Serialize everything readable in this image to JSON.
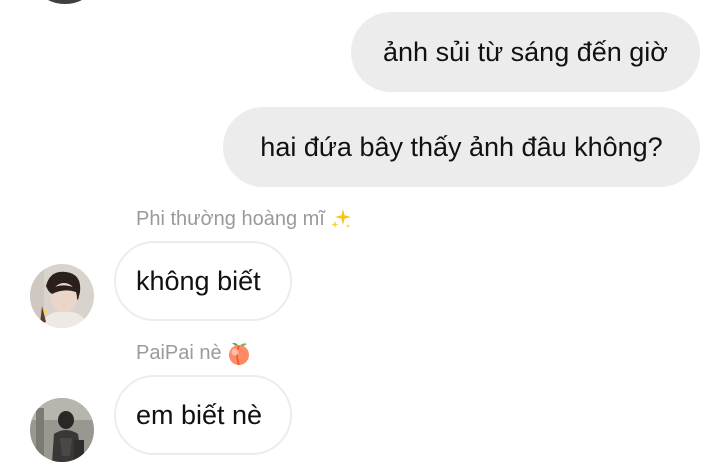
{
  "messages": {
    "outgoing": [
      {
        "text": "ảnh sủi từ sáng đến giờ"
      },
      {
        "text": "hai đứa bây thấy ảnh đâu không?"
      }
    ],
    "incoming": [
      {
        "sender": "Phi thường hoàng mĩ",
        "sender_emoji": "sparkles-icon",
        "text": "không biết"
      },
      {
        "sender": "PaiPai nè",
        "sender_emoji": "peach-icon",
        "text": "em biết nè"
      }
    ]
  },
  "colors": {
    "outgoing_bubble": "#ececec",
    "incoming_bubble_border": "#ececec",
    "sender_name": "#9a9a9a",
    "message_text": "#111111"
  }
}
